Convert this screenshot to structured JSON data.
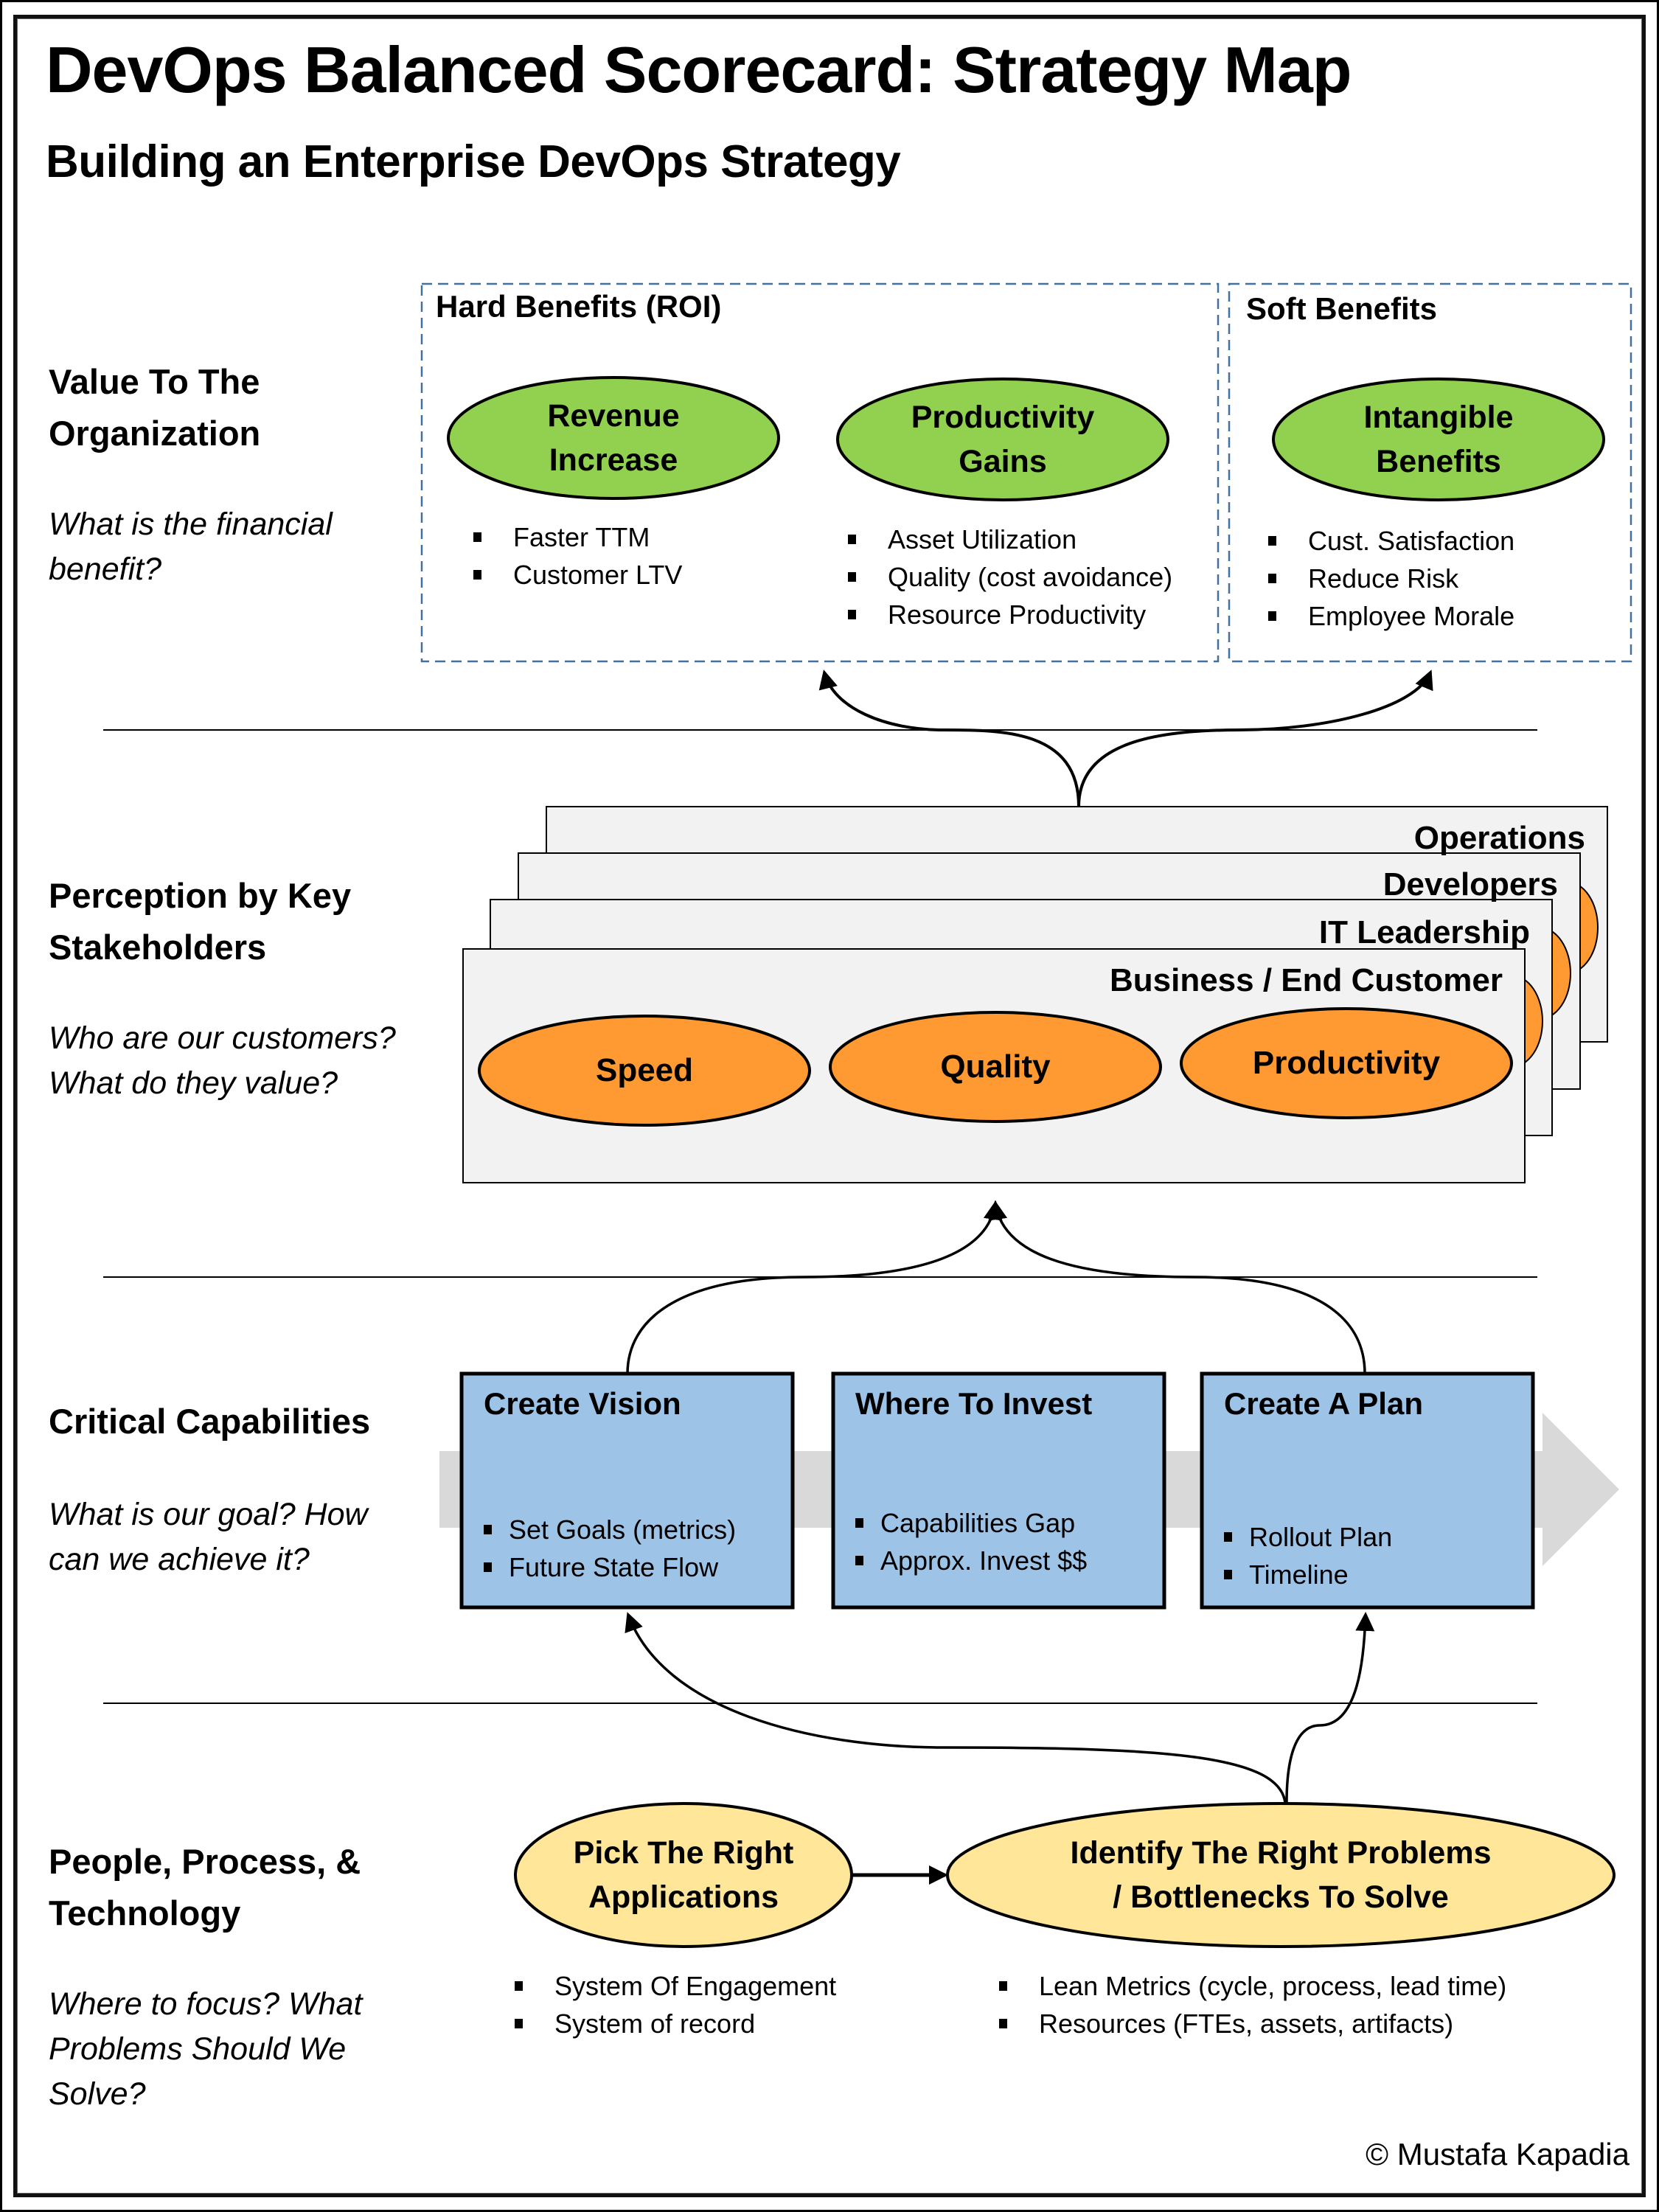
{
  "header": {
    "title": "DevOps Balanced Scorecard: Strategy Map",
    "subtitle": "Building an Enterprise DevOps Strategy"
  },
  "colors": {
    "benefit_oval": "#92D050",
    "stakeholder_oval": "#FF9A33",
    "capability_box": "#9DC3E6",
    "ppt_oval": "#FFE699",
    "stakeholder_card": "#F2F2F2",
    "dashed_border": "#41719C",
    "flow_arrow": "#D9D9D9"
  },
  "rows": [
    {
      "heading": "Value To The Organization",
      "question": "What is the financial benefit?"
    },
    {
      "heading": "Perception by Key Stakeholders",
      "question": "Who are our customers? What do they value?"
    },
    {
      "heading": "Critical Capabilities",
      "question": "What is our goal?  How can we achieve it?"
    },
    {
      "heading": "People, Process, & Technology",
      "question": "Where to focus? What Problems Should We Solve?"
    }
  ],
  "value": {
    "hard_benefits": {
      "title": "Hard Benefits (ROI)",
      "groups": [
        {
          "oval": [
            "Revenue",
            "Increase"
          ],
          "bullets": [
            "Faster TTM",
            "Customer LTV"
          ]
        },
        {
          "oval": [
            "Productivity",
            "Gains"
          ],
          "bullets": [
            "Asset Utilization",
            "Quality (cost avoidance)",
            "Resource Productivity"
          ]
        }
      ]
    },
    "soft_benefits": {
      "title": "Soft Benefits",
      "groups": [
        {
          "oval": [
            "Intangible",
            "Benefits"
          ],
          "bullets": [
            "Cust. Satisfaction",
            "Reduce Risk",
            "Employee Morale"
          ]
        }
      ]
    }
  },
  "stakeholders": {
    "cards": [
      "Operations",
      "Developers",
      "IT Leadership",
      "Business / End Customer"
    ],
    "values": [
      "Speed",
      "Quality",
      "Productivity"
    ]
  },
  "capabilities": [
    {
      "title": "Create Vision",
      "bullets": [
        "Set Goals (metrics)",
        "Future State Flow"
      ]
    },
    {
      "title": "Where To Invest",
      "bullets": [
        "Capabilities Gap",
        "Approx. Invest $$"
      ]
    },
    {
      "title": "Create A Plan",
      "bullets": [
        "Rollout Plan",
        "Timeline"
      ]
    }
  ],
  "ppt": [
    {
      "oval": [
        "Pick The Right",
        "Applications"
      ],
      "bullets": [
        "System Of Engagement",
        "System of record"
      ]
    },
    {
      "oval": [
        "Identify The Right Problems",
        "/ Bottlenecks To Solve"
      ],
      "bullets": [
        "Lean Metrics (cycle, process, lead time)",
        "Resources (FTEs, assets, artifacts)"
      ]
    }
  ],
  "footer": {
    "copyright": "© Mustafa Kapadia"
  }
}
